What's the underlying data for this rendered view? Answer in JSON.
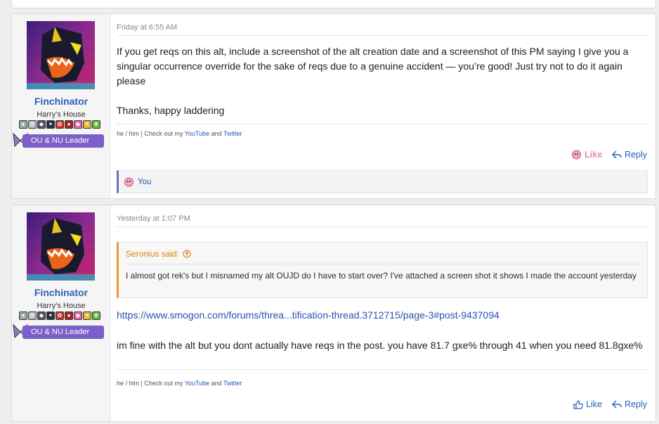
{
  "posts": [
    {
      "username": "Finchinator",
      "usergroup": "Harry's House",
      "banner": "OU & NU Leader",
      "date": "Friday at 6:55 AM",
      "body": [
        "If you get reqs on this alt, include a screenshot of the alt creation date and a screenshot of this PM saying I give you a singular occurrence override for the sake of reqs due to a genuine accident — you’re good! Just try not to do it again please",
        "Thanks, happy laddering"
      ],
      "signature": {
        "prefix": "he / him | Check out my ",
        "link1": "YouTube",
        "mid": " and ",
        "link2": "Twitter"
      },
      "like_label": "Like",
      "reply_label": "Reply",
      "reaction_user": "You"
    },
    {
      "username": "Finchinator",
      "usergroup": "Harry's House",
      "banner": "OU & NU Leader",
      "date": "Yesterday at 1:07 PM",
      "quote": {
        "author": "Seronius said:",
        "text": "I almost got rek's but I misnamed my alt OUJD do I have to start over? I've attached a screen shot it shows I made the account yesterday"
      },
      "link": "https://www.smogon.com/forums/threa...tification-thread.3712715/page-3#post-9437094",
      "body": "im fine with the alt but you dont actually have reqs in the post. you have 81.7 gxe% through 41 when you need 81.8gxe%",
      "signature": {
        "prefix": "he / him | Check out my ",
        "link1": "YouTube",
        "mid": " and ",
        "link2": "Twitter"
      },
      "like_label": "Like",
      "reply_label": "Reply"
    }
  ],
  "colors": {
    "accent": "#2b5fb6",
    "banner": "#7c5fc8",
    "quote_border": "#ee9a28",
    "like_active": "#e58bb5"
  },
  "badge_icons": [
    "pokeball-icon",
    "gear-icon",
    "mask-icon",
    "sprite-icon",
    "rose-icon",
    "bug-icon",
    "gem-icon",
    "sun-icon",
    "leaf-icon"
  ]
}
